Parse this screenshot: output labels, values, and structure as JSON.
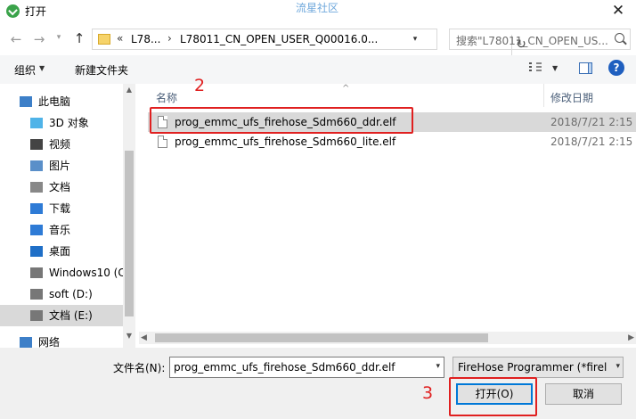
{
  "window": {
    "title": "打开",
    "watermark": "流星社区",
    "close_glyph": "✕"
  },
  "navigation": {
    "back_glyph": "←",
    "forward_glyph": "→",
    "recent_glyph": "▾",
    "up_glyph": "↑"
  },
  "address": {
    "overflow": "«",
    "segments": [
      "L78...",
      "L78011_CN_OPEN_USER_Q00016.0..."
    ],
    "separator": "›",
    "dropdown_glyph": "▾",
    "refresh_glyph": "↻"
  },
  "search": {
    "placeholder": "搜索\"L78011_CN_OPEN_US..."
  },
  "toolbar": {
    "organize_label": "组织",
    "organize_arrow": "▼",
    "new_folder_label": "新建文件夹",
    "view_arrow": "▼",
    "help_glyph": "?"
  },
  "sidebar": {
    "items": [
      {
        "label": "此电脑",
        "icon": "computer-icon"
      },
      {
        "label": "3D 对象",
        "icon": "3d-objects-icon"
      },
      {
        "label": "视频",
        "icon": "video-icon"
      },
      {
        "label": "图片",
        "icon": "pictures-icon"
      },
      {
        "label": "文档",
        "icon": "documents-icon"
      },
      {
        "label": "下载",
        "icon": "download-icon"
      },
      {
        "label": "音乐",
        "icon": "music-icon"
      },
      {
        "label": "桌面",
        "icon": "desktop-icon"
      },
      {
        "label": "Windows10 (C:",
        "icon": "drive-windows-icon"
      },
      {
        "label": "soft (D:)",
        "icon": "drive-icon"
      },
      {
        "label": "文档 (E:)",
        "icon": "drive-icon"
      },
      {
        "label": "网络",
        "icon": "network-icon"
      }
    ],
    "selected_index": 10,
    "scroll_up_glyph": "▲",
    "scroll_down_glyph": "▼"
  },
  "file_list": {
    "columns": {
      "name": "名称",
      "date": "修改日期",
      "sort_glyph": "^"
    },
    "files": [
      {
        "name": "prog_emmc_ufs_firehose_Sdm660_ddr.elf",
        "date": "2018/7/21 2:15",
        "selected": true
      },
      {
        "name": "prog_emmc_ufs_firehose_Sdm660_lite.elf",
        "date": "2018/7/21 2:15",
        "selected": false
      }
    ],
    "hscroll_left_glyph": "◀",
    "hscroll_right_glyph": "▶"
  },
  "bottom": {
    "filename_label": "文件名(N):",
    "filename_value": "prog_emmc_ufs_firehose_Sdm660_ddr.elf",
    "filename_arrow": "▾",
    "filter_value": "FireHose Programmer (*firel",
    "filter_arrow": "▾",
    "open_label": "打开(O)",
    "cancel_label": "取消"
  },
  "annotations": {
    "step_file": "2",
    "step_open": "3",
    "color": "#e02020"
  }
}
